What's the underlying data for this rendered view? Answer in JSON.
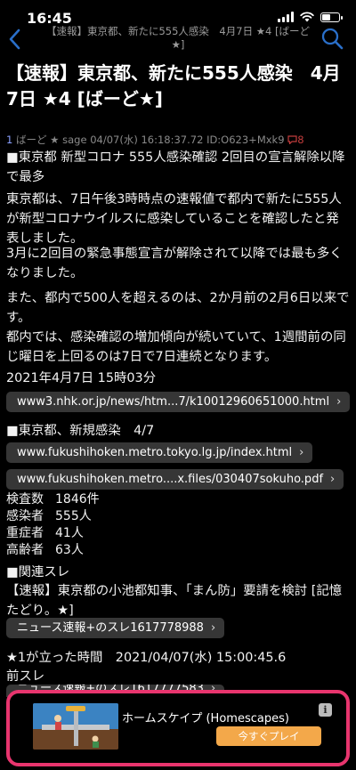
{
  "status_bar": {
    "time": "16:45"
  },
  "nav": {
    "title": "【速報】東京都、新たに555人感染　4月7日 ★4 [ばーど★]"
  },
  "thread": {
    "title": "【速報】東京都、新たに555人感染　4月7日 ★4 [ばーど★]"
  },
  "post": {
    "number": "1",
    "name": "ばーど ★",
    "mail": "sage",
    "datetime": "04/07(水) 16:18:37.72",
    "id": "ID:O623+Mxk9",
    "reply_count": "8",
    "headline": "■東京都 新型コロナ 555人感染確認 2回目の宣言解除以降で最多",
    "para1": "東京都は、7日午後3時時点の速報値で都内で新たに555人が新型コロナウイルスに感染していることを確認したと発表しました。",
    "para2": "3月に2回目の緊急事態宣言が解除されて以降では最も多くなりました。",
    "para3": "また、都内で500人を超えるのは、2か月前の2月6日以来です。",
    "para4": "都内では、感染確認の増加傾向が続いていて、1週間前の同じ曜日を上回るのは7日で7日連続となります。",
    "date_line": "2021年4月7日 15時03分",
    "link1": "www3.nhk.or.jp/news/htm...7/k10012960651000.html",
    "section2": "■東京都、新規感染　4/7",
    "link2": "www.fukushihoken.metro.tokyo.lg.jp/index.html",
    "link3": "www.fukushihoken.metro....x.files/030407sokuho.pdf",
    "stats": [
      {
        "label": "検査数",
        "value": "1846件"
      },
      {
        "label": "感染者",
        "value": "555人"
      },
      {
        "label": "重症者",
        "value": "41人"
      },
      {
        "label": "高齢者",
        "value": "63人"
      }
    ],
    "related_heading": "■関連スレ",
    "related_title": "【速報】東京都の小池都知事、「まん防」要請を検討 [記憶たどり。★]",
    "link4": "ニュース速報+のスレ1617778988",
    "time_line": "★1が立った時間　2021/04/07(水) 15:00:45.6",
    "prev_thread": "前スレ",
    "link5_partial": "ニュース速報+のスレ1617777583"
  },
  "ad": {
    "title": "ホームスケイプ (Homescapes)",
    "cta": "今すぐプレイ",
    "info": "i"
  },
  "colors": {
    "background": "#000000",
    "accent_link": "#8aa0ff",
    "ad_border": "#e8356e",
    "cta": "#f3a84a"
  }
}
